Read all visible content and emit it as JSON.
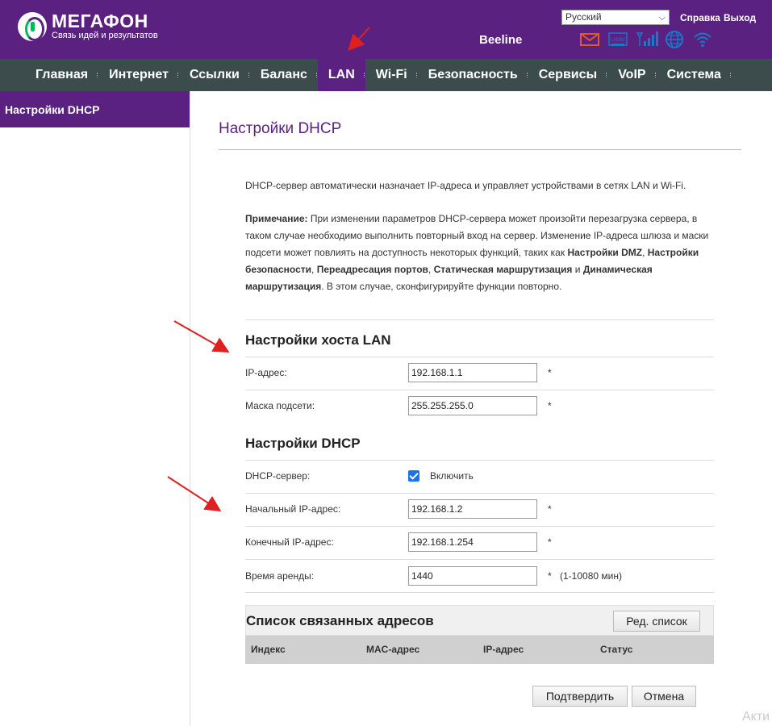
{
  "header": {
    "brand_name": "МегаФон",
    "brand_slogan": "Связь идей и результатов",
    "language": "Русский",
    "help_link": "Справка",
    "logout_link": "Выход",
    "operator": "Beeline",
    "icons": [
      "mail-icon",
      "usim-icon",
      "signal-icon",
      "globe-icon",
      "wifi-icon"
    ],
    "usim_label": "USIM"
  },
  "nav": {
    "items": [
      "Главная",
      "Интернет",
      "Ссылки",
      "Баланс",
      "LAN",
      "Wi-Fi",
      "Безопасность",
      "Сервисы",
      "VoIP",
      "Система"
    ],
    "active": "LAN"
  },
  "sidebar": {
    "items": [
      "Настройки DHCP"
    ]
  },
  "page": {
    "title": "Настройки DHCP",
    "description": "DHCP-сервер автоматически назначает IP-адреса и управляет устройствами в сетях LAN и Wi-Fi.",
    "note_label": "Примечание:",
    "note_text_1": " При изменении параметров DHCP-сервера может произойти перезагрузка сервера, в таком случае необходимо выполнить повторный вход на сервер. Изменение IP-адреса шлюза и маски подсети может повлиять на доступность некоторых функций, таких как ",
    "note_bold_1": "Настройки DMZ",
    "note_sep_1": ", ",
    "note_bold_2": "Настройки безопасности",
    "note_sep_2": ", ",
    "note_bold_3": "Переадресация портов",
    "note_sep_3": ", ",
    "note_bold_4": "Статическая маршрутизация",
    "note_sep_4": " и ",
    "note_bold_5": "Динамическая маршрутизация",
    "note_text_2": ". В этом случае, сконфигурируйте функции повторно."
  },
  "lan_host": {
    "section_title": "Настройки хоста LAN",
    "ip_label": "IP-адрес:",
    "ip_value": "192.168.1.1",
    "mask_label": "Маска подсети:",
    "mask_value": "255.255.255.0",
    "required_mark": "*"
  },
  "dhcp": {
    "section_title": "Настройки DHCP",
    "server_label": "DHCP-сервер:",
    "server_enabled": true,
    "enable_label": "Включить",
    "start_label": "Начальный IP-адрес:",
    "start_value": "192.168.1.2",
    "end_label": "Конечный IP-адрес:",
    "end_value": "192.168.1.254",
    "lease_label": "Время аренды:",
    "lease_value": "1440",
    "lease_range": "(1-10080 мин)",
    "required_mark": "*"
  },
  "bound_list": {
    "title": "Список связанных адресов",
    "edit_button": "Ред. список",
    "columns": [
      "Индекс",
      "MAC-адрес",
      "IP-адрес",
      "Статус"
    ]
  },
  "actions": {
    "confirm": "Подтвердить",
    "cancel": "Отмена"
  },
  "watermark": "Акти",
  "colors": {
    "brand": "#5a2181",
    "nav_bg": "#3c4b4b",
    "accent_green": "#00b956",
    "icon_orange": "#e2572b",
    "icon_blue": "#1b77c7",
    "annotation_arrow": "#e02020"
  }
}
